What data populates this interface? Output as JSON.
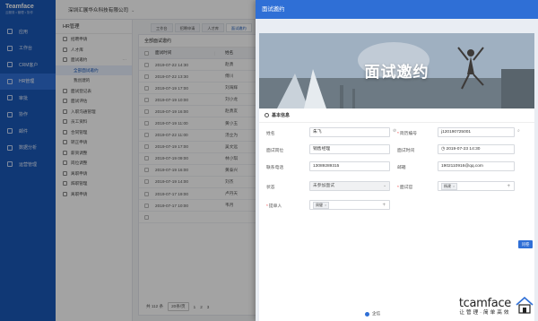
{
  "app": {
    "brand": "Teamface",
    "brand_sub": "云服务 • 管理 • 协作"
  },
  "sidebar": {
    "items": [
      {
        "label": "应用"
      },
      {
        "label": "工作台"
      },
      {
        "label": "CRM客户"
      },
      {
        "label": "HR管理"
      },
      {
        "label": "审批"
      },
      {
        "label": "协作"
      },
      {
        "label": "邮件"
      },
      {
        "label": "数据分析"
      },
      {
        "label": "运营管理"
      }
    ],
    "active_index": 3
  },
  "topbar": {
    "company": "深圳汇展华众科技有限公司"
  },
  "subnav": {
    "title": "HR管理",
    "items": [
      {
        "label": "招聘申请"
      },
      {
        "label": "人才库"
      },
      {
        "label": "面试邀约"
      },
      {
        "label": "全部面试邀约"
      },
      {
        "label": "我创建的"
      },
      {
        "label": "面试登记表"
      },
      {
        "label": "面试评估"
      },
      {
        "label": "入职沟通管理"
      },
      {
        "label": "员工资料"
      },
      {
        "label": "合同管理"
      },
      {
        "label": "转正申请"
      },
      {
        "label": "薪资调整"
      },
      {
        "label": "岗位调整"
      },
      {
        "label": "离职申请"
      },
      {
        "label": "辞职管理"
      },
      {
        "label": "离职申请"
      }
    ]
  },
  "tabs": [
    {
      "label": "工作台"
    },
    {
      "label": "招聘申请"
    },
    {
      "label": "人才库"
    },
    {
      "label": "面试邀约"
    }
  ],
  "list": {
    "title": "全部面试邀约",
    "col_time": "面试时间",
    "col_name": "姓名",
    "rows": [
      {
        "time": "2019-07-22 14:30",
        "name": "赵勇"
      },
      {
        "time": "2019-07-22 13:30",
        "name": "傅川"
      },
      {
        "time": "2019-07-19 17:00",
        "name": "刘海辉"
      },
      {
        "time": "2019-07-19 10:00",
        "name": "刘小龙"
      },
      {
        "time": "2019-07-19 16:00",
        "name": "赵勇友"
      },
      {
        "time": "2019-07-19 11:00",
        "name": "黄小玉"
      },
      {
        "time": "2019-07-22 11:00",
        "name": "汤立为"
      },
      {
        "time": "2019-07-19 17:00",
        "name": "吴文远"
      },
      {
        "time": "2019-07-19 09:00",
        "name": "林小琪"
      },
      {
        "time": "2019-07-19 16:00",
        "name": "黄泰兴"
      },
      {
        "time": "2019-07-19 14:00",
        "name": "刘杰"
      },
      {
        "time": "2019-07-17 19:00",
        "name": "卢丹天"
      },
      {
        "time": "2019-07-17 10:00",
        "name": "韦月"
      },
      {
        "time": "",
        "name": ""
      }
    ],
    "pager": {
      "total": "共 112 条",
      "size": "20条/页",
      "pages": [
        "1",
        "2",
        "3"
      ]
    }
  },
  "drawer": {
    "title": "面试邀约",
    "banner_title": "面试邀约",
    "section": "基本信息",
    "fields": {
      "name_label": "姓名",
      "name_value": "朱飞",
      "resume_label": "简历编号",
      "resume_value": "j120190725001",
      "position_label": "面试岗位",
      "position_value": "销售经理",
      "time_label": "面试时间",
      "time_value": "2019-07-23 14:30",
      "phone_label": "联系电话",
      "phone_value": "13089289315",
      "email_label": "邮箱",
      "email_value": "1902110916@qq.com",
      "status_label": "状态",
      "status_value": "未参加面试",
      "interviewer_label": "面试官",
      "interviewer_tag": "杨建",
      "submitter_label": "提单人",
      "submitter_tag": "周健"
    }
  },
  "footer_hint": "企信",
  "watermark": {
    "big": "tcamface",
    "small": "让管理·简单高效"
  },
  "qa_badge": "问卷",
  "colors": {
    "brand": "#1a58b8",
    "drawer_head": "#2f6fd6"
  }
}
